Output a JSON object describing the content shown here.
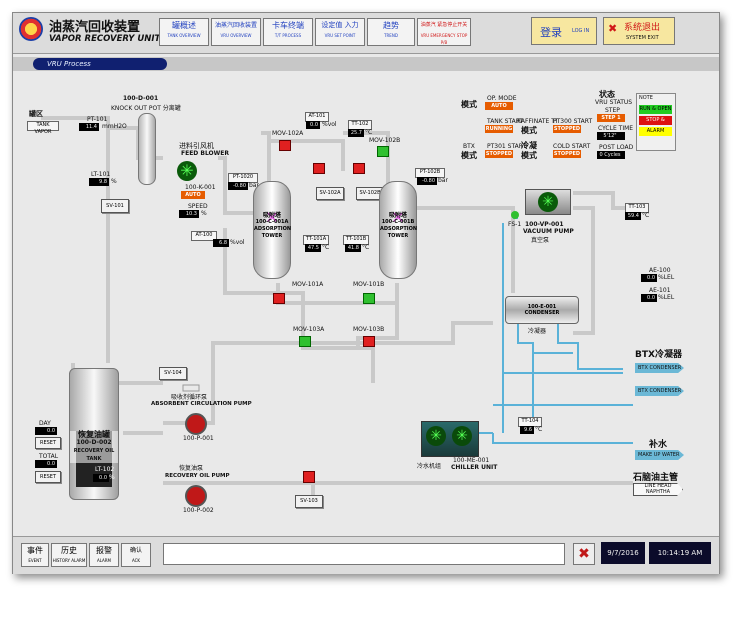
{
  "header": {
    "title_cn": "油蒸汽回收装置",
    "title_en": "VAPOR RECOVERY UNIT",
    "nav": [
      {
        "cn": "罐概述",
        "en": "TANK OVERVIEW"
      },
      {
        "cn": "油蒸汽回收装置",
        "en": "VRU OVERVIEW"
      },
      {
        "cn": "卡车终端",
        "en": "T/T PROCESS"
      },
      {
        "cn": "设定值 入力",
        "en": "VRU SET POINT"
      },
      {
        "cn": "趋势",
        "en": "TREND"
      },
      {
        "cn": "油蒸汽 紧急停止开关",
        "en": "VRU EMERGENCY STOP P/B"
      }
    ],
    "login": {
      "cn": "登录",
      "en": "LOG IN"
    },
    "exit": {
      "cn": "系统退出",
      "en": "SYSTEM EXIT"
    }
  },
  "tab": "VRU Process",
  "process": {
    "tank_zone_cn": "罐区",
    "tank_vapor": "TANK VAPOR",
    "knockout_tag": "100-D-001",
    "knockout_name": "KNOCK OUT POT 分离罐",
    "pt101": {
      "tag": "PT-101",
      "value": "11.4",
      "unit": "mmH2O"
    },
    "lt101": {
      "tag": "LT-101",
      "value": "9.8",
      "unit": "%"
    },
    "sv101": "SV-101",
    "feed_blower_cn": "进料引风机",
    "feed_blower_en": "FEED BLOWER",
    "blower_tag": "100-K-001",
    "blower_mode": "AUTO",
    "speed_label": "SPEED",
    "speed": {
      "value": "10.3",
      "unit": "%"
    },
    "pt1020": {
      "tag": "PT-1020",
      "value": "-0.80",
      "unit": "bar"
    },
    "at100": {
      "tag": "AT-100",
      "value": "6.8",
      "unit": "%vol"
    },
    "at101": {
      "tag": "AT-101",
      "value": "0.0",
      "unit": "%vol"
    },
    "tt102": {
      "tag": "TT-102",
      "value": "25.7",
      "unit": "°C"
    },
    "mov102a": "MOV-102A",
    "mov102b": "MOV-102B",
    "sv102a": "SV-102A",
    "sv102b": "SV-102B",
    "tower_a": {
      "cn": "吸附塔",
      "tag": "100-C-001A",
      "name": "ADSORPTION TOWER"
    },
    "tower_b": {
      "cn": "吸附塔",
      "tag": "100-C-001B",
      "name": "ADSORPTION TOWER"
    },
    "tt101a": {
      "tag": "TT-101A",
      "value": "47.5",
      "unit": "°C"
    },
    "tt101b": {
      "tag": "TT-101B",
      "value": "41.8",
      "unit": "°C"
    },
    "pt102b": {
      "tag": "PT-102B",
      "value": "-0.80",
      "unit": "bar"
    },
    "mov101a": "MOV-101A",
    "mov101b": "MOV-101B",
    "mov103a": "MOV-103A",
    "mov103b": "MOV-103B",
    "vacuum_tag": "100-VP-001",
    "vacuum_name": "VACUUM PUMP",
    "vacuum_cn": "真空泵",
    "fs": "FS-1",
    "tt103": {
      "tag": "TT-103",
      "value": "59.4",
      "unit": "°C"
    },
    "ae100": {
      "tag": "AE-100",
      "value": "0.0",
      "unit": "%LEL"
    },
    "ae101": {
      "tag": "AE-101",
      "value": "0.0",
      "unit": "%LEL"
    },
    "condenser_tag": "100-E-001",
    "condenser_name": "CONDENSER",
    "condenser_cn": "冷凝器",
    "btx_cn": "BTX冷凝器",
    "btx1": "BTX CONDENSER",
    "btx2": "BTX CONDENSER",
    "sv104": "SV-104",
    "absorbent_pump_cn": "吸收剂循环泵",
    "absorbent_pump": "ABSORBENT CIRCULATION PUMP",
    "pump_p001": "100-P-001",
    "recovery_pump_cn": "恢复油泵",
    "recovery_pump": "RECOVERY OIL PUMP",
    "pump_p002": "100-P-002",
    "sv103": "SV-103",
    "tt104": {
      "tag": "TT-104",
      "value": "9.6",
      "unit": "°C"
    },
    "chiller_cn": "冷水机组",
    "chiller_tag": "100-ME-001",
    "chiller_name": "CHILLER UNIT",
    "makeup_cn": "补水",
    "makeup": "MAKE UP WATER",
    "gasoline_cn": "石脑油主管",
    "gasoline": "LINE HEAD NAPHTHA",
    "tank_cn": "恢复油罐",
    "tank_tag": "100-D-002",
    "tank_name": "RECOVERY OIL TANK",
    "lt102": {
      "tag": "LT-102",
      "value": "0.0",
      "unit": "%"
    },
    "day_label": "DAY",
    "day_value": "0.0",
    "total_label": "TOTAL",
    "total_value": "0.0",
    "reset": "RESET"
  },
  "mode_panel": {
    "mode_cn": "模式",
    "op_mode_label": "OP. MODE",
    "op_mode": "AUTO",
    "tank_start_label": "TANK START",
    "tank_start": "RUNNING",
    "raffinate_label": "RAFFINATE TT",
    "raffinate_cn": "模式",
    "pt300_label": "PT300 START",
    "pt300": "STOPPED",
    "btx_label": "BTX",
    "btx_mode_cn": "模式",
    "pt301_label": "PT301 START",
    "pt301": "STOPPED",
    "cold_cn": "冷凝",
    "cold_mode_cn": "模式",
    "cold_start_label": "COLD START",
    "cold_start": "STOPPED",
    "status_cn": "状态",
    "status_en": "VRU STATUS",
    "step_label": "STEP",
    "step": "STEP 1",
    "cycle_label": "CYCLE TIME",
    "cycle": "5'12\"",
    "post_load_label": "POST LOAD",
    "post_load": "0 Cycles"
  },
  "legend": {
    "title": "NOTE",
    "items": [
      "RUN & OPEN",
      "STOP & CLOSE",
      "ALARM"
    ],
    "colors": [
      "#22cc22",
      "#dd1111",
      "#ffff00"
    ]
  },
  "footer": {
    "event": {
      "cn": "事件",
      "en": "EVENT"
    },
    "history": {
      "cn": "历史",
      "en": "HISTORY ALARM"
    },
    "alarm": {
      "cn": "报警",
      "en": "ALARM"
    },
    "ack": {
      "cn": "确认",
      "en": "ACK"
    },
    "date": "9/7/2016",
    "time": "10:14:19 AM"
  }
}
